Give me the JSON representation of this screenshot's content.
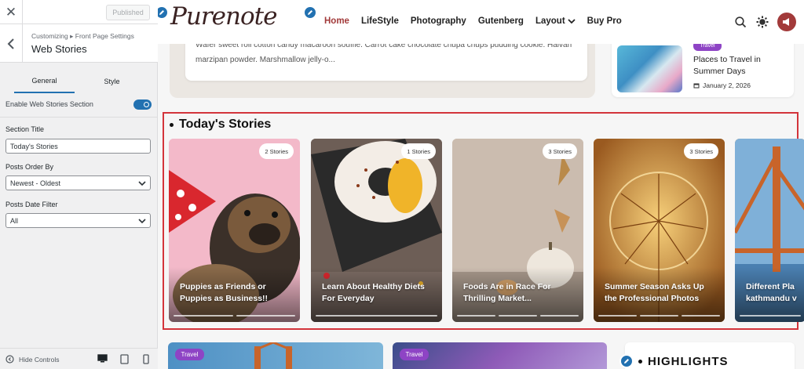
{
  "customizer": {
    "close_glyph": "✕",
    "published_label": "Published",
    "breadcrumb": "Customizing ▸ Front Page Settings",
    "section_title": "Web Stories",
    "tabs": [
      "General",
      "Style"
    ],
    "enable_label": "Enable Web Stories Section",
    "enable_value": true,
    "section_title_label": "Section Title",
    "section_title_value": "Today's Stories",
    "order_label": "Posts Order By",
    "order_value": "Newest - Oldest",
    "date_filter_label": "Posts Date Filter",
    "date_filter_value": "All",
    "hide_controls_label": "Hide Controls",
    "devices": [
      "desktop-icon",
      "tablet-icon",
      "mobile-icon"
    ]
  },
  "site": {
    "logo": "Purenote",
    "menu": [
      {
        "label": "Home",
        "active": true
      },
      {
        "label": "LifeStyle",
        "active": false
      },
      {
        "label": "Photography",
        "active": false
      },
      {
        "label": "Gutenberg",
        "active": false
      },
      {
        "label": "Layout",
        "active": false,
        "has_dropdown": true
      },
      {
        "label": "Buy Pro",
        "active": false
      }
    ],
    "top_card_text": "Wafer sweet roll cotton candy macaroon soufflé. Carrot cake chocolate chupa chups pudding cookie. Halvah marzipan powder. Marshmallow jelly-o...",
    "side_card": {
      "badge": "Travel",
      "title": "Places to Travel in Summer Days",
      "date": "January 2, 2026"
    },
    "stories_heading": "Today's Stories",
    "stories": [
      {
        "badge": "2 Stories",
        "caption": "Puppies as Friends or Puppies as Business!!"
      },
      {
        "badge": "1 Stories",
        "caption": "Learn About Healthy Diets For Everyday"
      },
      {
        "badge": "3 Stories",
        "caption": "Foods Are in Race For Thrilling Market..."
      },
      {
        "badge": "3 Stories",
        "caption": "Summer Season Asks Up the Professional Photos"
      },
      {
        "badge": "",
        "caption": "Different Pla kathmandu v"
      }
    ],
    "bottom_badges": [
      "Travel",
      "Travel"
    ],
    "highlights_title": "HIGHLIGHTS"
  },
  "colors": {
    "accent": "#2271b1",
    "brand": "#a23a3a",
    "badge_purple": "#8e44c5",
    "selection_red": "#d3343b"
  }
}
